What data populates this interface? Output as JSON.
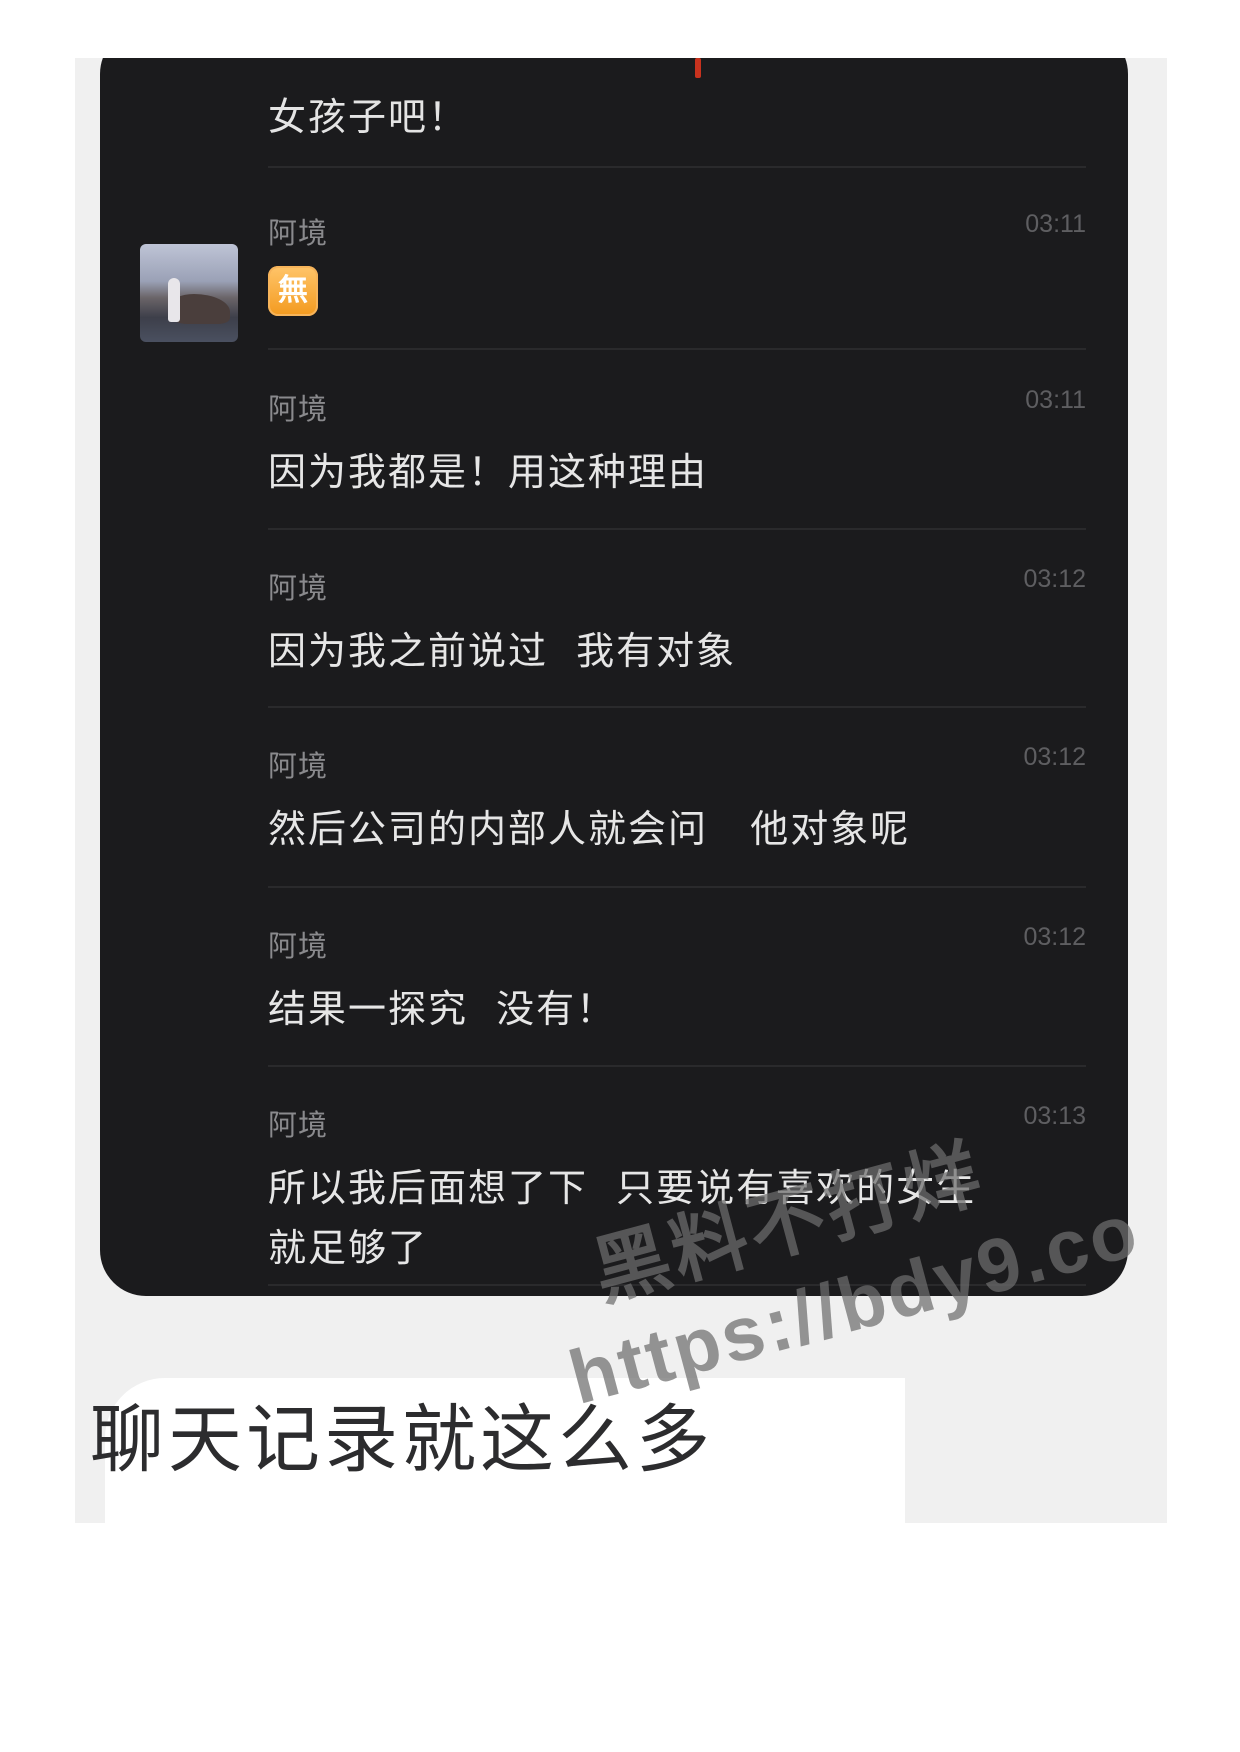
{
  "chat": {
    "top_fragment": "女孩子吧！",
    "messages": [
      {
        "sender": "阿境",
        "time": "03:11",
        "emoji": "無",
        "text": ""
      },
      {
        "sender": "阿境",
        "time": "03:11",
        "text": "因为我都是！用这种理由"
      },
      {
        "sender": "阿境",
        "time": "03:12",
        "text": "因为我之前说过  我有对象"
      },
      {
        "sender": "阿境",
        "time": "03:12",
        "text": "然后公司的内部人就会问   他对象呢"
      },
      {
        "sender": "阿境",
        "time": "03:12",
        "text": "结果一探究  没有！"
      },
      {
        "sender": "阿境",
        "time": "03:13",
        "text": "所以我后面想了下  只要说有喜欢的女生\n就足够了"
      }
    ]
  },
  "caption": "聊天记录就这么多",
  "watermark": {
    "line1": "黑料不打烊",
    "line2": "https://bdy9.co"
  },
  "colors": {
    "panel_bg": "#1b1b1d",
    "text": "#e6e6e6",
    "sender": "#8a8a8d",
    "time": "#5e5e61",
    "emoji_badge": "#f39a1f"
  }
}
